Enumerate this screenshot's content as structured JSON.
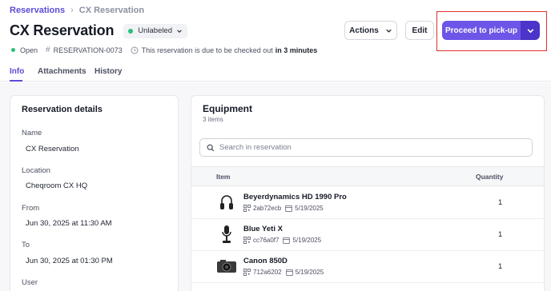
{
  "breadcrumb": {
    "parent": "Reservations",
    "current": "CX Reservation"
  },
  "header": {
    "title": "CX Reservation",
    "label_badge": "Unlabeled",
    "status": "Open",
    "reservation_id": "RESERVATION-0073",
    "due_text": "This reservation is due to be checked out",
    "due_strong": "in 3 minutes"
  },
  "actions": {
    "actions_label": "Actions",
    "edit_label": "Edit",
    "primary_label": "Proceed to pick-up"
  },
  "tabs": [
    {
      "label": "Info"
    },
    {
      "label": "Attachments"
    },
    {
      "label": "History"
    }
  ],
  "details": {
    "title": "Reservation details",
    "fields": [
      {
        "label": "Name",
        "value": "CX Reservation"
      },
      {
        "label": "Location",
        "value": "Cheqroom CX HQ"
      },
      {
        "label": "From",
        "value": "Jun 30, 2025 at 11:30 AM"
      },
      {
        "label": "To",
        "value": "Jun 30, 2025 at 01:30 PM"
      },
      {
        "label": "User",
        "value": ""
      }
    ]
  },
  "equipment": {
    "title": "Equipment",
    "count": "3 items",
    "search_placeholder": "Search in reservation",
    "columns": {
      "item": "Item",
      "quantity": "Quantity"
    },
    "items": [
      {
        "name": "Beyerdynamics HD 1990 Pro",
        "code": "2ab72ecb",
        "date": "5/19/2025",
        "qty": "1",
        "icon": "headphones"
      },
      {
        "name": "Blue Yeti X",
        "code": "cc76a0f7",
        "date": "5/19/2025",
        "qty": "1",
        "icon": "microphone"
      },
      {
        "name": "Canon 850D",
        "code": "712a6202",
        "date": "5/19/2025",
        "qty": "1",
        "icon": "camera"
      }
    ]
  },
  "colors": {
    "accent": "#6d55e8",
    "accent_dark": "#4a34c9",
    "status_green": "#2bbf7a",
    "highlight_red": "#e0312c"
  }
}
